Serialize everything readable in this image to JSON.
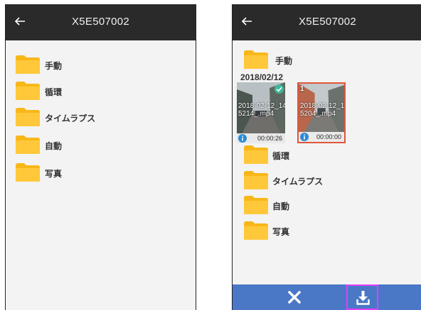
{
  "screens": {
    "left": {
      "title": "X5E507002",
      "folders": [
        "手動",
        "循環",
        "タイムラプス",
        "自動",
        "写真"
      ]
    },
    "right": {
      "title": "X5E507002",
      "top_folder": "手動",
      "date_header": "2018/02/12",
      "thumbnails": [
        {
          "name_line1": "2018-02-12_14",
          "name_line2": "5214_.mp4",
          "duration": "00:00:26",
          "selected": true
        },
        {
          "badge": "1",
          "name_line1": "2018-02-12_14",
          "name_line2": "5204_.mp4",
          "duration": "00:00:00",
          "selected": false
        }
      ],
      "folders": [
        "循環",
        "タイムラプス",
        "自動",
        "写真"
      ]
    }
  },
  "colors": {
    "appbar": "#2a2a2a",
    "folder": "#f8b719",
    "bottombar": "#4a78c6",
    "highlight": "#e040fb",
    "check": "#3fb89a",
    "info": "#2a8bd6"
  },
  "icons": {
    "back": "arrow-left-icon",
    "folder": "folder-icon",
    "close": "close-icon",
    "download": "download-icon",
    "info": "info-icon",
    "check": "check-icon"
  }
}
